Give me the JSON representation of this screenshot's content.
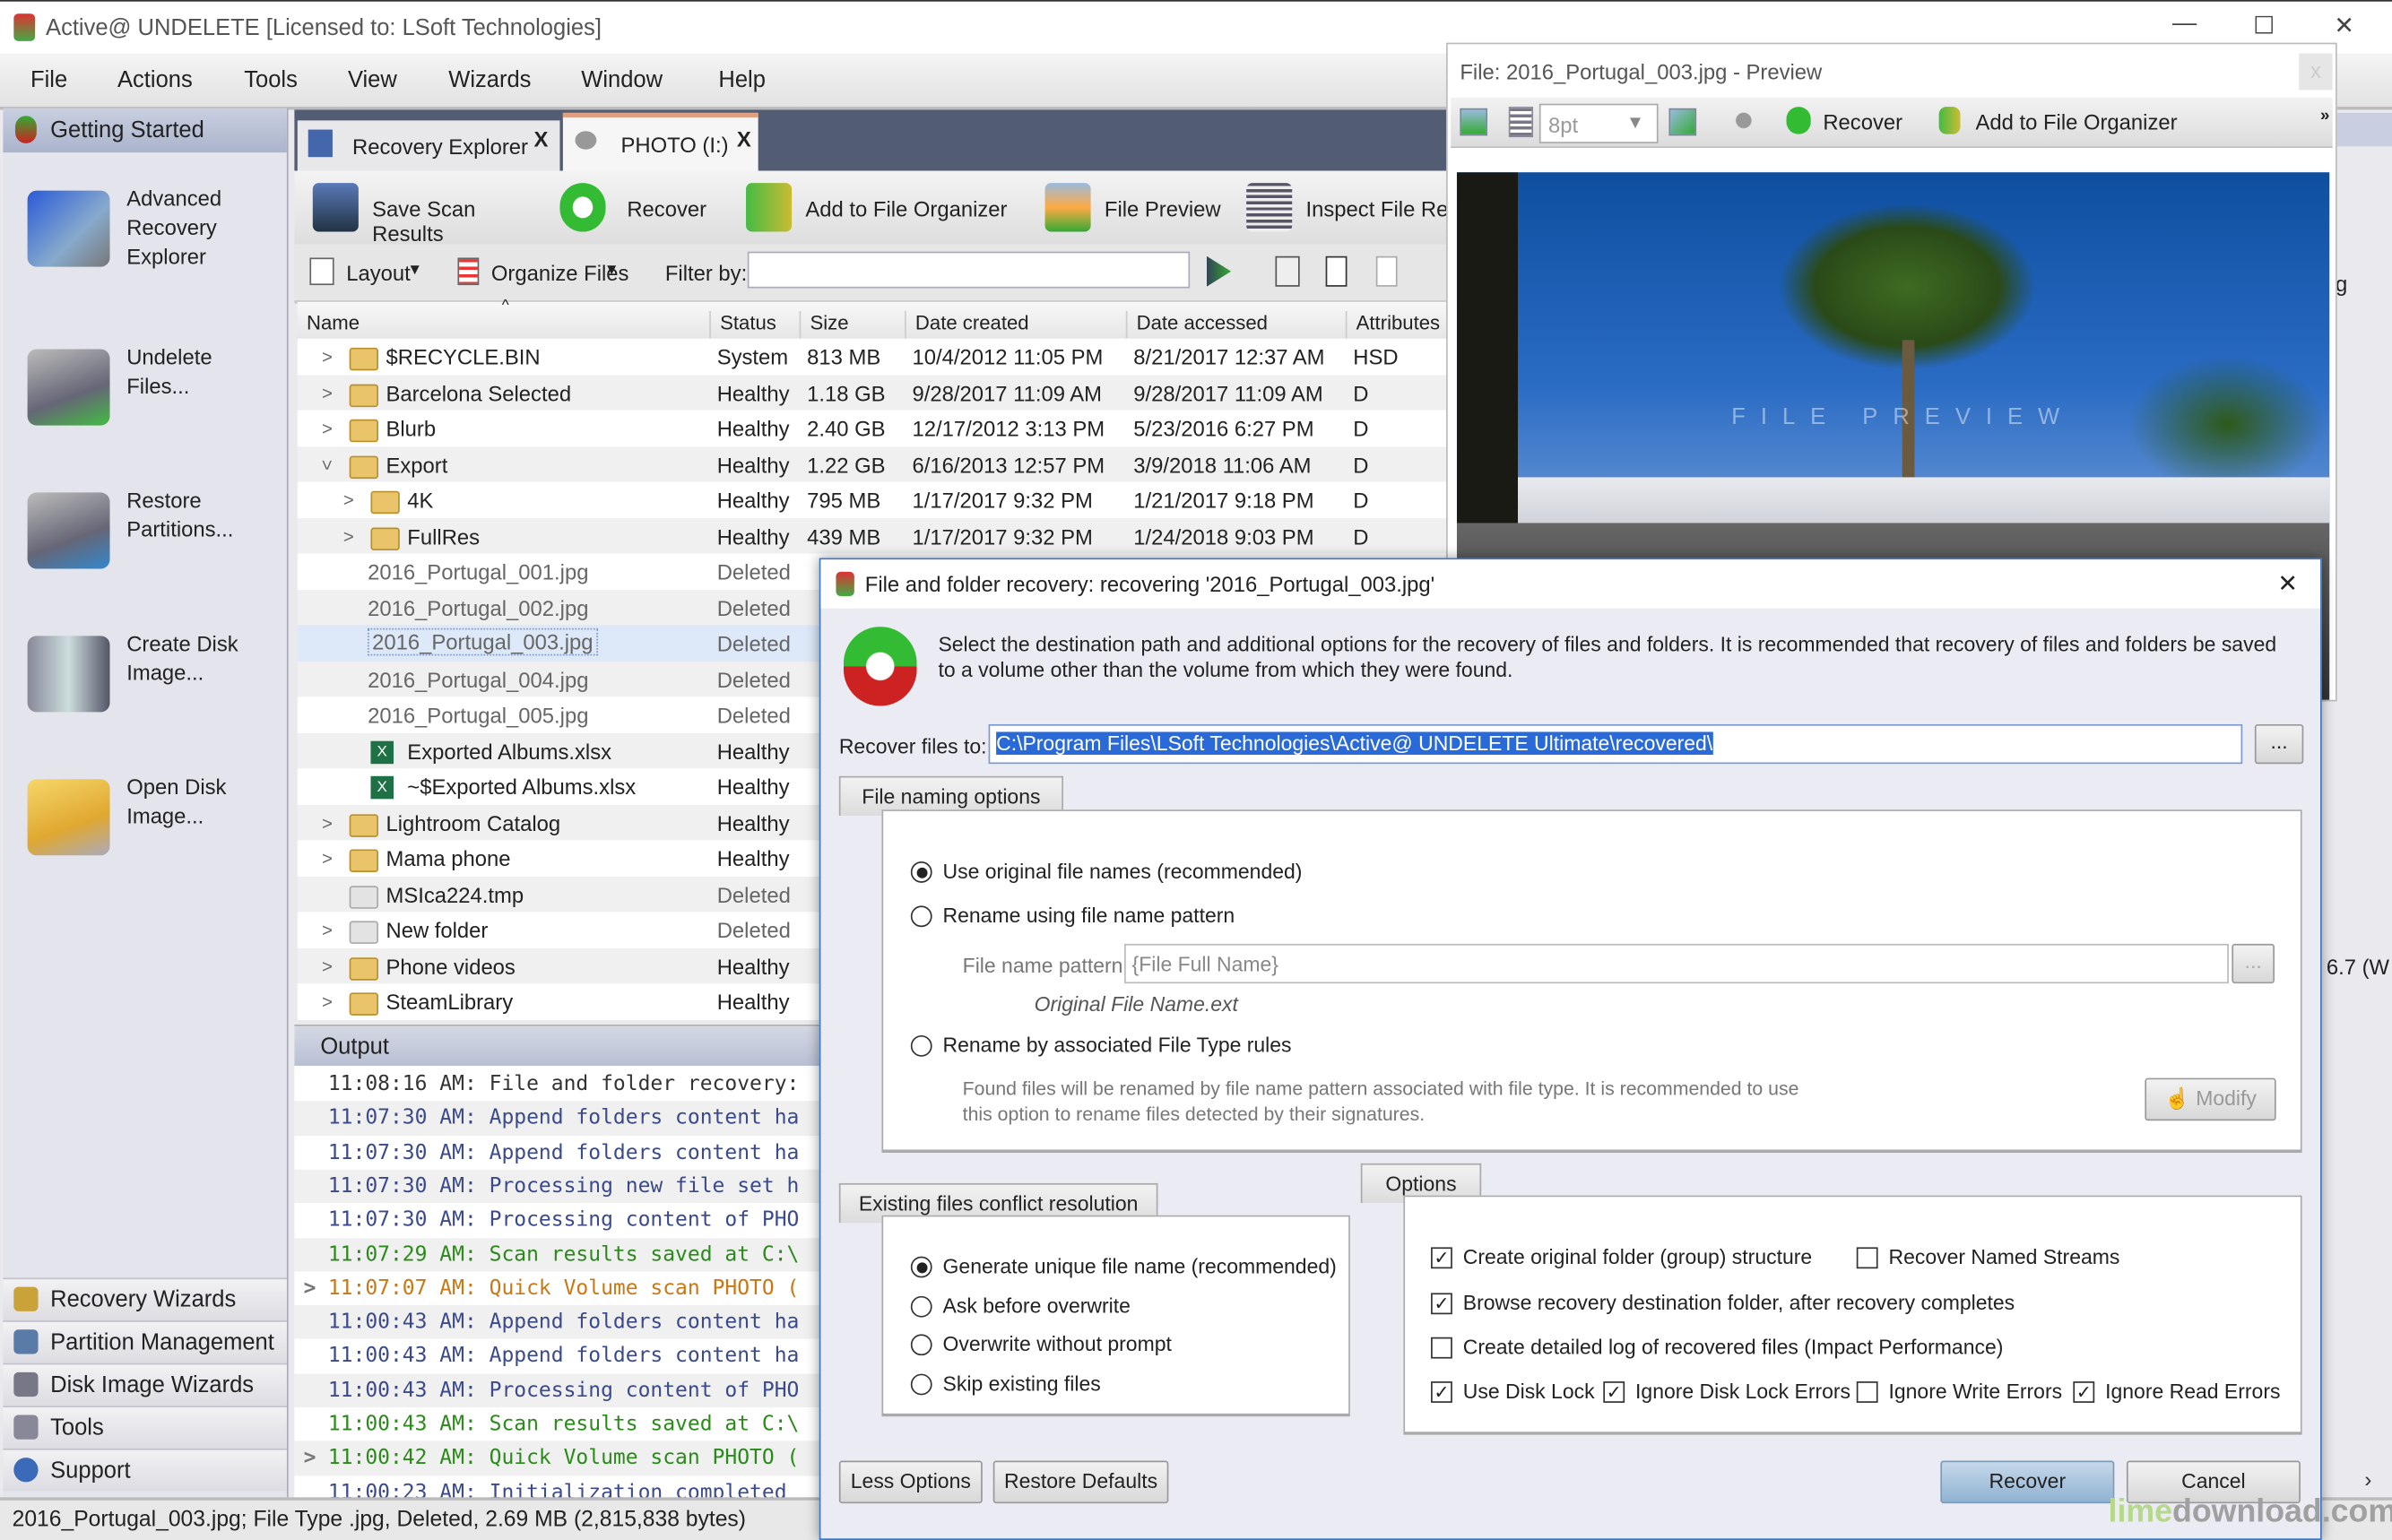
{
  "window": {
    "title": "Active@ UNDELETE [Licensed to: LSoft Technologies]"
  },
  "menu": [
    "File",
    "Actions",
    "Tools",
    "View",
    "Wizards",
    "Window",
    "Help"
  ],
  "sidebar": {
    "header": "Getting Started",
    "items": [
      {
        "label": "Advanced Recovery Explorer",
        "icon": "monitor-icon"
      },
      {
        "label": "Undelete Files...",
        "icon": "drive-undelete-icon"
      },
      {
        "label": "Restore Partitions...",
        "icon": "drive-restore-icon"
      },
      {
        "label": "Create Disk Image...",
        "icon": "disk-image-icon"
      },
      {
        "label": "Open Disk Image...",
        "icon": "folder-disk-icon"
      }
    ],
    "sections": [
      "Recovery Wizards",
      "Partition Management",
      "Disk Image Wizards",
      "Tools",
      "Support"
    ]
  },
  "tabs": [
    {
      "label": "Recovery Explorer"
    },
    {
      "label": "PHOTO (I:)",
      "active": true
    }
  ],
  "toolbar": {
    "save": "Save Scan Results",
    "recover": "Recover",
    "organizer": "Add to File Organizer",
    "preview": "File Preview",
    "inspect": "Inspect File Rec"
  },
  "filterbar": {
    "layout": "Layout",
    "organize": "Organize Files",
    "filter_label": "Filter by:",
    "filter_value": ""
  },
  "table": {
    "columns": [
      "Name",
      "Status",
      "Size",
      "Date created",
      "Date accessed",
      "Attributes"
    ],
    "rows": [
      {
        "name": "$RECYCLE.BIN",
        "status": "System",
        "size": "813 MB",
        "created": "10/4/2012 11:05 PM",
        "accessed": "8/21/2017 12:37 AM",
        "attr": "HSD",
        "type": "folder",
        "level": 0,
        "exp": ">"
      },
      {
        "name": "Barcelona Selected",
        "status": "Healthy",
        "size": "1.18 GB",
        "created": "9/28/2017 11:09 AM",
        "accessed": "9/28/2017 11:09 AM",
        "attr": "D",
        "type": "folder",
        "level": 0,
        "exp": ">"
      },
      {
        "name": "Blurb",
        "status": "Healthy",
        "size": "2.40 GB",
        "created": "12/17/2012 3:13 PM",
        "accessed": "5/23/2016 6:27 PM",
        "attr": "D",
        "type": "folder",
        "level": 0,
        "exp": ">"
      },
      {
        "name": "Export",
        "status": "Healthy",
        "size": "1.22 GB",
        "created": "6/16/2013 12:57 PM",
        "accessed": "3/9/2018 11:06 AM",
        "attr": "D",
        "type": "folder",
        "level": 0,
        "exp": "v"
      },
      {
        "name": "4K",
        "status": "Healthy",
        "size": "795 MB",
        "created": "1/17/2017 9:32 PM",
        "accessed": "1/21/2017 9:18 PM",
        "attr": "D",
        "type": "folder",
        "level": 1,
        "exp": ">"
      },
      {
        "name": "FullRes",
        "status": "Healthy",
        "size": "439 MB",
        "created": "1/17/2017 9:32 PM",
        "accessed": "1/24/2018 9:03 PM",
        "attr": "D",
        "type": "folder",
        "level": 1,
        "exp": ">"
      },
      {
        "name": "2016_Portugal_001.jpg",
        "status": "Deleted",
        "size": "",
        "created": "",
        "accessed": "",
        "attr": "",
        "type": "deleted",
        "level": 1,
        "exp": ""
      },
      {
        "name": "2016_Portugal_002.jpg",
        "status": "Deleted",
        "size": "",
        "created": "",
        "accessed": "",
        "attr": "",
        "type": "deleted",
        "level": 1,
        "exp": ""
      },
      {
        "name": "2016_Portugal_003.jpg",
        "status": "Deleted",
        "size": "",
        "created": "",
        "accessed": "",
        "attr": "",
        "type": "deleted",
        "level": 1,
        "exp": "",
        "selected": true
      },
      {
        "name": "2016_Portugal_004.jpg",
        "status": "Deleted",
        "size": "",
        "created": "",
        "accessed": "",
        "attr": "",
        "type": "deleted",
        "level": 1,
        "exp": ""
      },
      {
        "name": "2016_Portugal_005.jpg",
        "status": "Deleted",
        "size": "",
        "created": "",
        "accessed": "",
        "attr": "",
        "type": "deleted",
        "level": 1,
        "exp": ""
      },
      {
        "name": "Exported Albums.xlsx",
        "status": "Healthy",
        "size": "",
        "created": "",
        "accessed": "",
        "attr": "",
        "type": "xlsx",
        "level": 1,
        "exp": ""
      },
      {
        "name": "~$Exported Albums.xlsx",
        "status": "Healthy",
        "size": "",
        "created": "",
        "accessed": "",
        "attr": "",
        "type": "xlsx",
        "level": 1,
        "exp": ""
      },
      {
        "name": "Lightroom Catalog",
        "status": "Healthy",
        "size": "",
        "created": "",
        "accessed": "",
        "attr": "",
        "type": "folder",
        "level": 0,
        "exp": ">"
      },
      {
        "name": "Mama phone",
        "status": "Healthy",
        "size": "",
        "created": "",
        "accessed": "",
        "attr": "",
        "type": "folder",
        "level": 0,
        "exp": ">"
      },
      {
        "name": "MSIca224.tmp",
        "status": "Deleted",
        "size": "",
        "created": "",
        "accessed": "",
        "attr": "",
        "type": "gfolder",
        "level": 0,
        "exp": ""
      },
      {
        "name": "New folder",
        "status": "Deleted",
        "size": "",
        "created": "",
        "accessed": "",
        "attr": "",
        "type": "gfolder",
        "level": 0,
        "exp": ">"
      },
      {
        "name": "Phone videos",
        "status": "Healthy",
        "size": "",
        "created": "",
        "accessed": "",
        "attr": "",
        "type": "folder",
        "level": 0,
        "exp": ">"
      },
      {
        "name": "SteamLibrary",
        "status": "Healthy",
        "size": "",
        "created": "",
        "accessed": "",
        "attr": "",
        "type": "folder",
        "level": 0,
        "exp": ">"
      }
    ]
  },
  "output": {
    "title": "Output",
    "lines": [
      {
        "text": "11:08:16 AM: File and folder recovery:",
        "color": "#333333"
      },
      {
        "text": "11:07:30 AM: Append folders content ha",
        "color": "#3a4a8a"
      },
      {
        "text": "11:07:30 AM: Append folders content ha",
        "color": "#3a4a8a"
      },
      {
        "text": "11:07:30 AM: Processing new file set h",
        "color": "#3a4a8a"
      },
      {
        "text": "11:07:30 AM: Processing content of PHO",
        "color": "#3a4a8a"
      },
      {
        "text": "11:07:29 AM: Scan results saved at C:\\",
        "color": "#2a8a1a"
      },
      {
        "text": "11:07:07 AM: Quick Volume scan PHOTO (",
        "color": "#c87814",
        "exp": true
      },
      {
        "text": "11:00:43 AM: Append folders content ha",
        "color": "#3a4a8a"
      },
      {
        "text": "11:00:43 AM: Append folders content ha",
        "color": "#3a4a8a"
      },
      {
        "text": "11:00:43 AM: Processing content of PHO",
        "color": "#3a4a8a"
      },
      {
        "text": "11:00:43 AM: Scan results saved at C:\\",
        "color": "#2a8a1a"
      },
      {
        "text": "11:00:42 AM: Quick Volume scan PHOTO (",
        "color": "#2a8a1a",
        "exp": true
      },
      {
        "text": "11:00:23 AM: Initialization completed",
        "color": "#3a4a8a"
      }
    ]
  },
  "status": "2016_Portugal_003.jpg; File Type .jpg, Deleted, 2.69 MB (2,815,838 bytes)",
  "preview": {
    "title": "File: 2016_Portugal_003.jpg - Preview",
    "font_size": "8pt",
    "recover": "Recover",
    "organizer": "Add to File Organizer",
    "watermark": "FILE PREVIEW",
    "close": "x"
  },
  "right_edge": {
    "text1": "g",
    "text2": "6.7 (W"
  },
  "dialog": {
    "title": "File and folder recovery: recovering '2016_Portugal_003.jpg'",
    "description": "Select the destination path and additional options for the recovery of files and folders.  It is recommended that recovery of files and folders be saved to a volume other than the volume from which they were found.",
    "recover_to_label": "Recover files to:",
    "recover_to_value": "C:\\Program Files\\LSoft Technologies\\Active@ UNDELETE Ultimate\\recovered\\",
    "browse": "...",
    "naming_tab": "File naming options",
    "naming": {
      "opt1": "Use original file names (recommended)",
      "opt2": "Rename using file name pattern",
      "pattern_label": "File name pattern:",
      "pattern_value": "{File Full Name}",
      "pattern_example": "Original File Name.ext",
      "opt3": "Rename by associated File Type rules",
      "opt3_desc": "Found files will be renamed by file name pattern associated with file type. It is recommended to use this option to rename files detected by their signatures.",
      "modify": "Modify",
      "selected": 1
    },
    "conflict_tab": "Existing files conflict resolution",
    "conflict": {
      "options": [
        "Generate unique file name (recommended)",
        "Ask before overwrite",
        "Overwrite without prompt",
        "Skip existing files"
      ],
      "selected": 0
    },
    "options_tab": "Options",
    "options": [
      {
        "label": "Create original folder (group) structure",
        "checked": true
      },
      {
        "label": "Recover Named Streams",
        "checked": false
      },
      {
        "label": "Browse recovery destination folder, after recovery completes",
        "checked": true
      },
      {
        "label": "Create detailed log of recovered files (Impact Performance)",
        "checked": false
      },
      {
        "label": "Use Disk Lock",
        "checked": true
      },
      {
        "label": "Ignore Disk Lock Errors",
        "checked": true
      },
      {
        "label": "Ignore Write Errors",
        "checked": false
      },
      {
        "label": "Ignore Read Errors",
        "checked": true
      }
    ],
    "less_options": "Less Options",
    "restore_defaults": "Restore Defaults",
    "recover": "Recover",
    "cancel": "Cancel",
    "close": "✕"
  },
  "watermark": {
    "lime": "lime",
    "download": "download.com"
  }
}
